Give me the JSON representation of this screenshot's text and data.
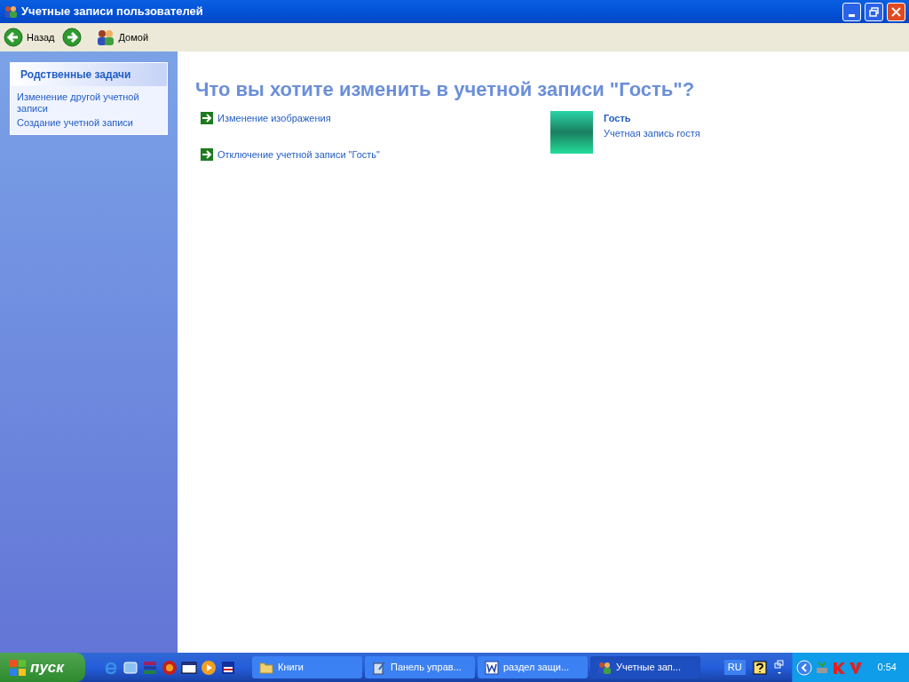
{
  "window": {
    "title": "Учетные записи пользователей"
  },
  "toolbar": {
    "back": "Назад",
    "home": "Домой"
  },
  "sidebar": {
    "title": "Родственные задачи",
    "items": [
      "Изменение другой учетной записи",
      "Создание учетной записи"
    ]
  },
  "content": {
    "heading": "Что вы хотите изменить в учетной записи \"Гость\"?",
    "tasks": [
      "Изменение изображения",
      "Отключение учетной записи \"Гость\""
    ],
    "account": {
      "name": "Гость",
      "description": "Учетная запись гостя"
    }
  },
  "taskbar": {
    "start": "пуск",
    "windows": [
      {
        "label": "Книги",
        "kind": "folder",
        "selected": false
      },
      {
        "label": "Панель управ...",
        "kind": "panel",
        "selected": false
      },
      {
        "label": "раздел защи...",
        "kind": "word",
        "selected": false
      },
      {
        "label": "Учетные зап...",
        "kind": "users",
        "selected": true
      }
    ],
    "language": "RU",
    "clock": "0:54"
  }
}
